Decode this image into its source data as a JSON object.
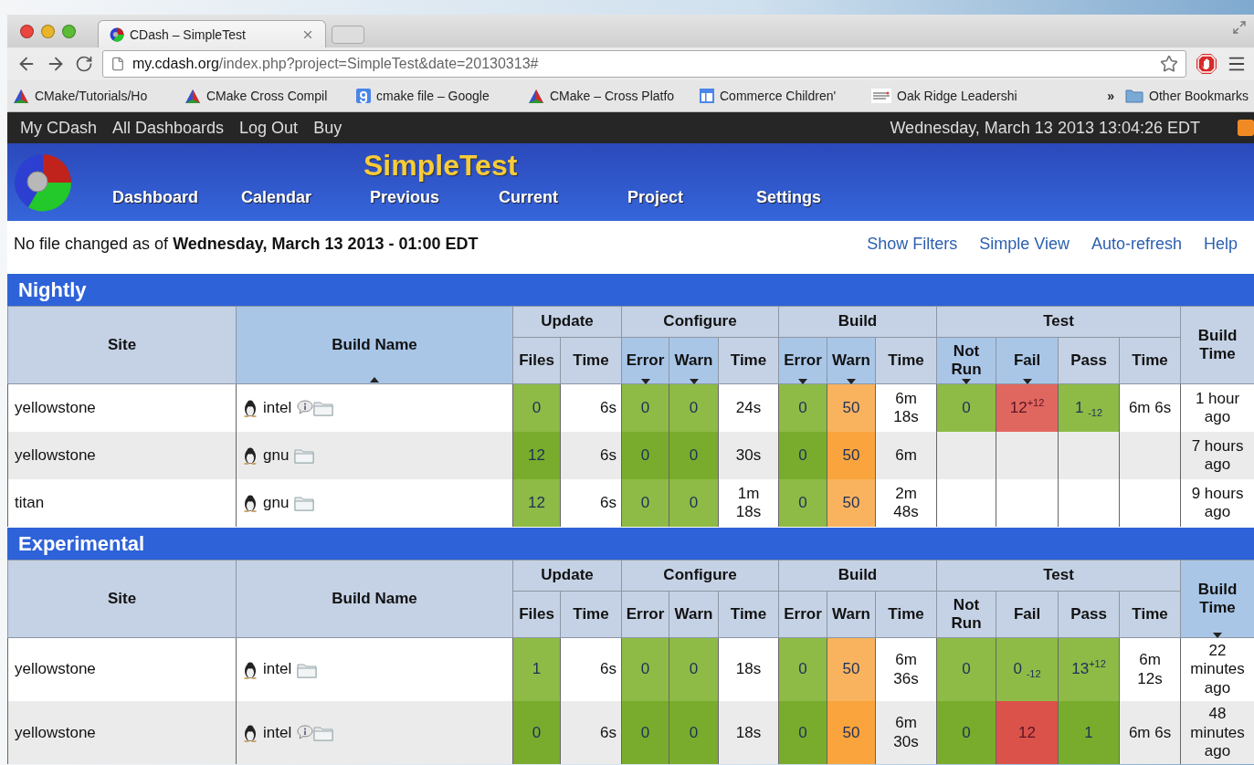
{
  "browser": {
    "tab_title": "CDash – SimpleTest",
    "url_host": "my.cdash.org",
    "url_path": "/index.php?project=SimpleTest&date=20130313#",
    "bookmarks": [
      {
        "label": "CMake/Tutorials/Ho",
        "kind": "cmake"
      },
      {
        "label": "CMake Cross Compil",
        "kind": "cmake"
      },
      {
        "label": "cmake file – Google",
        "kind": "google"
      },
      {
        "label": "CMake – Cross Platfo",
        "kind": "cmake"
      },
      {
        "label": "Commerce Children'",
        "kind": "page"
      },
      {
        "label": "Oak Ridge Leadershi",
        "kind": "lines"
      }
    ],
    "more": "»",
    "other_bookmarks": "Other Bookmarks"
  },
  "top_bar": {
    "links": [
      "My CDash",
      "All Dashboards",
      "Log Out",
      "Buy"
    ],
    "datetime": "Wednesday, March 13 2013 13:04:26 EDT"
  },
  "header": {
    "project": "SimpleTest",
    "nav": [
      "Dashboard",
      "Calendar",
      "Previous",
      "Current",
      "Project",
      "Settings"
    ]
  },
  "info": {
    "text": "No file changed as of **Wednesday, March 13 2013 - 01:00 EDT**",
    "links": [
      "Show Filters",
      "Simple View",
      "Auto-refresh",
      "Help"
    ]
  },
  "sections": [
    {
      "title": "Nightly",
      "site_column": {
        "label": "Site",
        "sorted": false
      },
      "name_column": {
        "label": "Build Name",
        "sorted": true,
        "ascending": true
      },
      "groups": [
        {
          "label": "Update",
          "columns": [
            {
              "label": "Files",
              "sorted": false
            },
            {
              "label": "Time",
              "sorted": false
            }
          ]
        },
        {
          "label": "Configure",
          "columns": [
            {
              "label": "Error",
              "sorted": true,
              "ascending": false
            },
            {
              "label": "Warn",
              "sorted": true,
              "ascending": false
            },
            {
              "label": "Time",
              "sorted": false
            }
          ]
        },
        {
          "label": "Build",
          "columns": [
            {
              "label": "Error",
              "sorted": true,
              "ascending": false
            },
            {
              "label": "Warn",
              "sorted": true,
              "ascending": false
            },
            {
              "label": "Time",
              "sorted": false
            }
          ]
        },
        {
          "label": "Test",
          "columns": [
            {
              "label": "Not Run",
              "sorted": true,
              "ascending": false
            },
            {
              "label": "Fail",
              "sorted": true,
              "ascending": false
            },
            {
              "label": "Pass",
              "sorted": false
            },
            {
              "label": "Time",
              "sorted": false
            }
          ]
        }
      ],
      "build_time_column": {
        "label": "Build Time",
        "sorted": false
      },
      "rows": [
        {
          "site": "yellowstone",
          "build": "intel",
          "notes": true,
          "cells": [
            {
              "text": "0",
              "kind": "ok"
            },
            {
              "text": "6s",
              "kind": "plain"
            },
            {
              "text": "0",
              "kind": "ok"
            },
            {
              "text": "0",
              "kind": "ok"
            },
            {
              "text": "24s",
              "kind": "plain"
            },
            {
              "text": "0",
              "kind": "ok"
            },
            {
              "text": "50",
              "kind": "warn"
            },
            {
              "text": "6m 18s",
              "kind": "plain"
            },
            {
              "text": "0",
              "kind": "ok"
            },
            {
              "text": "12$^{+12}$",
              "kind": "fail"
            },
            {
              "text": "1 $_{-12}$",
              "kind": "ok"
            },
            {
              "text": "6m 6s",
              "kind": "plain"
            }
          ],
          "build_time": "1 hour ago"
        },
        {
          "site": "yellowstone",
          "build": "gnu",
          "notes": false,
          "cells": [
            {
              "text": "12",
              "kind": "ok"
            },
            {
              "text": "6s",
              "kind": "plain"
            },
            {
              "text": "0",
              "kind": "ok"
            },
            {
              "text": "0",
              "kind": "ok"
            },
            {
              "text": "30s",
              "kind": "plain"
            },
            {
              "text": "0",
              "kind": "ok"
            },
            {
              "text": "50",
              "kind": "warn"
            },
            {
              "text": "6m",
              "kind": "plain"
            },
            {
              "kind": "plain"
            },
            {
              "kind": "plain"
            },
            {
              "kind": "plain"
            },
            {
              "kind": "plain"
            }
          ],
          "build_time": "7 hours ago"
        },
        {
          "site": "titan",
          "build": "gnu",
          "notes": false,
          "cells": [
            {
              "text": "12",
              "kind": "ok"
            },
            {
              "text": "6s",
              "kind": "plain"
            },
            {
              "text": "0",
              "kind": "ok"
            },
            {
              "text": "0",
              "kind": "ok"
            },
            {
              "text": "1m 18s",
              "kind": "plain"
            },
            {
              "text": "0",
              "kind": "ok"
            },
            {
              "text": "50",
              "kind": "warn"
            },
            {
              "text": "2m 48s",
              "kind": "plain"
            },
            {
              "kind": "plain"
            },
            {
              "kind": "plain"
            },
            {
              "kind": "plain"
            },
            {
              "kind": "plain"
            }
          ],
          "build_time": "9 hours ago"
        }
      ]
    },
    {
      "title": "Experimental",
      "site_column": {
        "label": "Site",
        "sorted": false
      },
      "name_column": {
        "label": "Build Name",
        "sorted": false
      },
      "groups": [
        {
          "label": "Update",
          "columns": [
            {
              "label": "Files",
              "sorted": false
            },
            {
              "label": "Time",
              "sorted": false
            }
          ]
        },
        {
          "label": "Configure",
          "columns": [
            {
              "label": "Error",
              "sorted": false
            },
            {
              "label": "Warn",
              "sorted": false
            },
            {
              "label": "Time",
              "sorted": false
            }
          ]
        },
        {
          "label": "Build",
          "columns": [
            {
              "label": "Error",
              "sorted": false
            },
            {
              "label": "Warn",
              "sorted": false
            },
            {
              "label": "Time",
              "sorted": false
            }
          ]
        },
        {
          "label": "Test",
          "columns": [
            {
              "label": "Not Run",
              "sorted": false
            },
            {
              "label": "Fail",
              "sorted": false
            },
            {
              "label": "Pass",
              "sorted": false
            },
            {
              "label": "Time",
              "sorted": false
            }
          ]
        }
      ],
      "build_time_column": {
        "label": "Build Time",
        "sorted": true,
        "ascending": false
      },
      "rows": [
        {
          "site": "yellowstone",
          "build": "intel",
          "notes": false,
          "cells": [
            {
              "text": "1",
              "kind": "ok"
            },
            {
              "text": "6s",
              "kind": "plain"
            },
            {
              "text": "0",
              "kind": "ok"
            },
            {
              "text": "0",
              "kind": "ok"
            },
            {
              "text": "18s",
              "kind": "plain"
            },
            {
              "text": "0",
              "kind": "ok"
            },
            {
              "text": "50",
              "kind": "warn"
            },
            {
              "text": "6m 36s",
              "kind": "plain"
            },
            {
              "text": "0",
              "kind": "ok"
            },
            {
              "text": "0 $_{-12}$",
              "kind": "ok"
            },
            {
              "text": "13$^{+12}$",
              "kind": "ok"
            },
            {
              "text": "6m 12s",
              "kind": "plain"
            }
          ],
          "build_time": "22 minutes ago"
        },
        {
          "site": "yellowstone",
          "build": "intel",
          "notes": true,
          "cells": [
            {
              "text": "0",
              "kind": "ok"
            },
            {
              "text": "6s",
              "kind": "plain"
            },
            {
              "text": "0",
              "kind": "ok"
            },
            {
              "text": "0",
              "kind": "ok"
            },
            {
              "text": "18s",
              "kind": "plain"
            },
            {
              "text": "0",
              "kind": "ok"
            },
            {
              "text": "50",
              "kind": "warn"
            },
            {
              "text": "6m 30s",
              "kind": "plain"
            },
            {
              "text": "0",
              "kind": "ok"
            },
            {
              "text": "12",
              "kind": "fail"
            },
            {
              "text": "1",
              "kind": "ok"
            },
            {
              "text": "6m 6s",
              "kind": "plain"
            }
          ],
          "build_time": "48 minutes ago"
        }
      ]
    }
  ]
}
